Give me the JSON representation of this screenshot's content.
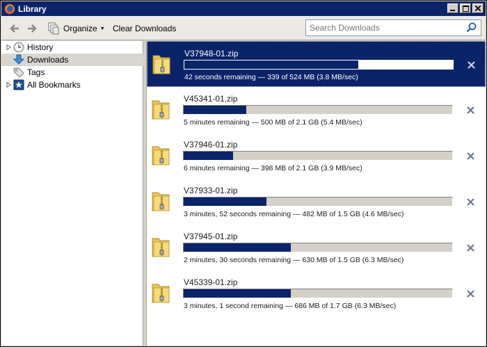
{
  "window": {
    "title": "Library",
    "buttons": [
      "minimize",
      "maximize",
      "close"
    ]
  },
  "toolbar": {
    "back_icon": "back-arrow-icon",
    "forward_icon": "forward-arrow-icon",
    "organize_label": "Organize",
    "clear_label": "Clear Downloads",
    "search_placeholder": "Search Downloads"
  },
  "sidebar": {
    "items": [
      {
        "label": "History",
        "icon": "history-clock-icon",
        "expandable": true,
        "selected": false
      },
      {
        "label": "Downloads",
        "icon": "download-arrow-icon",
        "expandable": false,
        "selected": true
      },
      {
        "label": "Tags",
        "icon": "tag-icon",
        "expandable": false,
        "selected": false
      },
      {
        "label": "All Bookmarks",
        "icon": "bookmark-star-icon",
        "expandable": true,
        "selected": false
      }
    ]
  },
  "downloads": [
    {
      "filename": "V37948-01.zip",
      "progress": 0.647,
      "status": "42 seconds remaining — 339 of 524 MB (3.8 MB/sec)",
      "selected": true
    },
    {
      "filename": "V45341-01.zip",
      "progress": 0.232,
      "status": "5 minutes remaining — 500 MB of 2.1 GB (5.4 MB/sec)",
      "selected": false
    },
    {
      "filename": "V37946-01.zip",
      "progress": 0.185,
      "status": "6 minutes remaining — 398 MB of 2.1 GB (3.9 MB/sec)",
      "selected": false
    },
    {
      "filename": "V37933-01.zip",
      "progress": 0.307,
      "status": "3 minutes, 52 seconds remaining — 482 MB of 1.5 GB (4.6 MB/sec)",
      "selected": false
    },
    {
      "filename": "V37945-01.zip",
      "progress": 0.4,
      "status": "2 minutes, 30 seconds remaining — 630 MB of 1.5 GB (6.3 MB/sec)",
      "selected": false
    },
    {
      "filename": "V45339-01.zip",
      "progress": 0.4,
      "status": "3 minutes, 1 second remaining — 686 MB of 1.7 GB (6.3 MB/sec)",
      "selected": false
    }
  ],
  "colors": {
    "titlebar": "#0a246a",
    "selection": "#0a246a",
    "progress_fill": "#0a246a",
    "window_bg": "#d4d0c8"
  }
}
